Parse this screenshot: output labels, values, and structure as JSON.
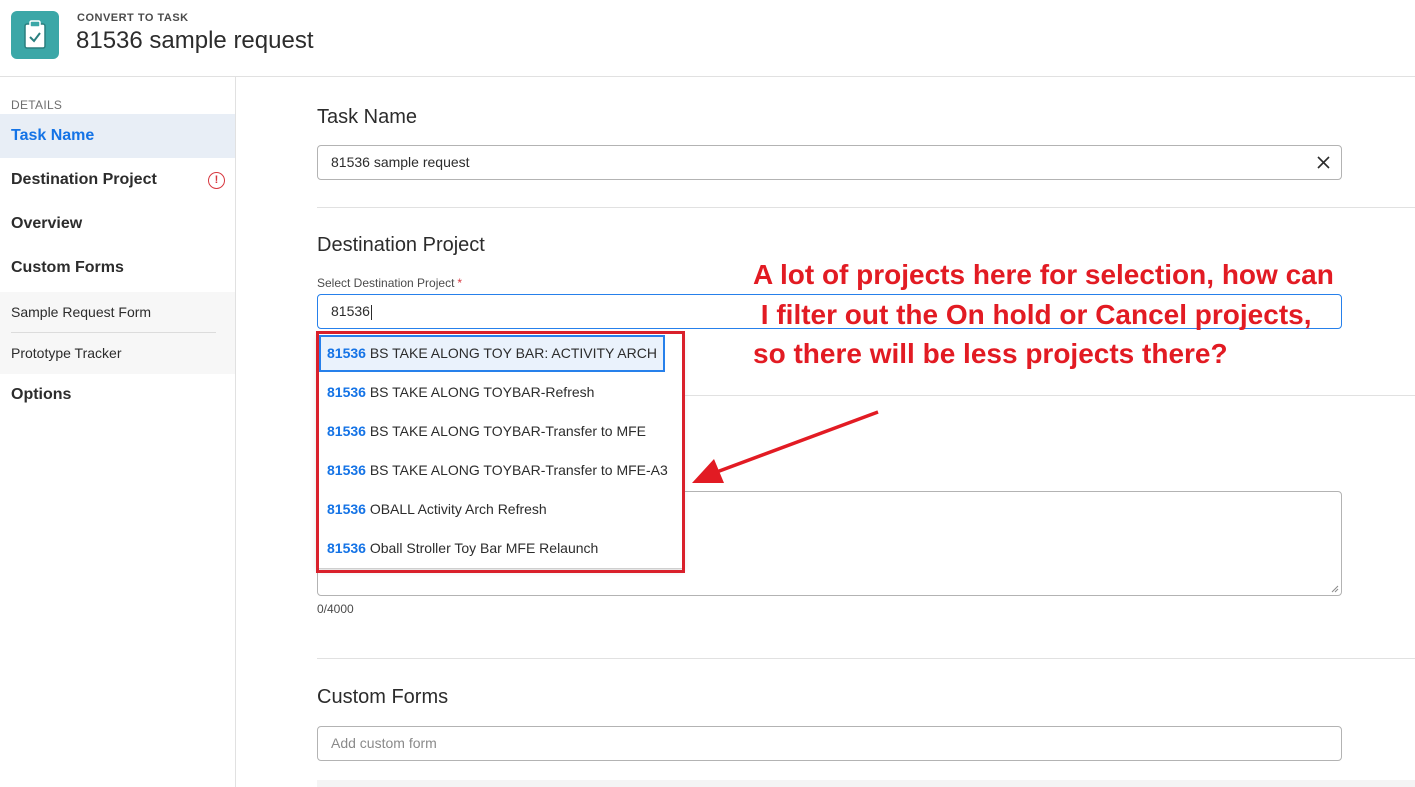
{
  "header": {
    "kicker": "CONVERT TO TASK",
    "title": "81536 sample request",
    "icon": "clipboard-check-icon",
    "accent_color": "#3ba7a7"
  },
  "sidebar": {
    "section_label": "DETAILS",
    "items": [
      {
        "label": "Task Name",
        "active": true
      },
      {
        "label": "Destination Project",
        "alert": true
      },
      {
        "label": "Overview"
      },
      {
        "label": "Custom Forms"
      }
    ],
    "sub_items": [
      {
        "label": "Sample Request Form"
      },
      {
        "label": "Prototype Tracker"
      }
    ],
    "options_label": "Options"
  },
  "task_name": {
    "title": "Task Name",
    "value": "81536 sample request"
  },
  "destination_project": {
    "title": "Destination Project",
    "field_label": "Select Destination Project",
    "required_mark": "*",
    "value": "81536",
    "dropdown": [
      {
        "match": "81536",
        "rest": " BS TAKE ALONG TOY BAR: ACTIVITY ARCH",
        "highlighted": true
      },
      {
        "match": "81536",
        "rest": " BS TAKE ALONG TOYBAR-Refresh"
      },
      {
        "match": "81536",
        "rest": " BS TAKE ALONG TOYBAR-Transfer to MFE"
      },
      {
        "match": "81536",
        "rest": " BS TAKE ALONG TOYBAR-Transfer to MFE-A3"
      },
      {
        "match": "81536",
        "rest": " OBALL Activity Arch Refresh"
      },
      {
        "match": "81536",
        "rest": " Oball Stroller Toy Bar MFE  Relaunch"
      }
    ]
  },
  "overview": {
    "counter": "0/4000"
  },
  "custom_forms": {
    "title": "Custom Forms",
    "placeholder": "Add custom form"
  },
  "annotation": {
    "lines": [
      "A lot of projects here for selection, how can",
      " I filter out the On hold or Cancel projects,",
      "so there will be less projects there?"
    ],
    "color": "#e21b23"
  }
}
